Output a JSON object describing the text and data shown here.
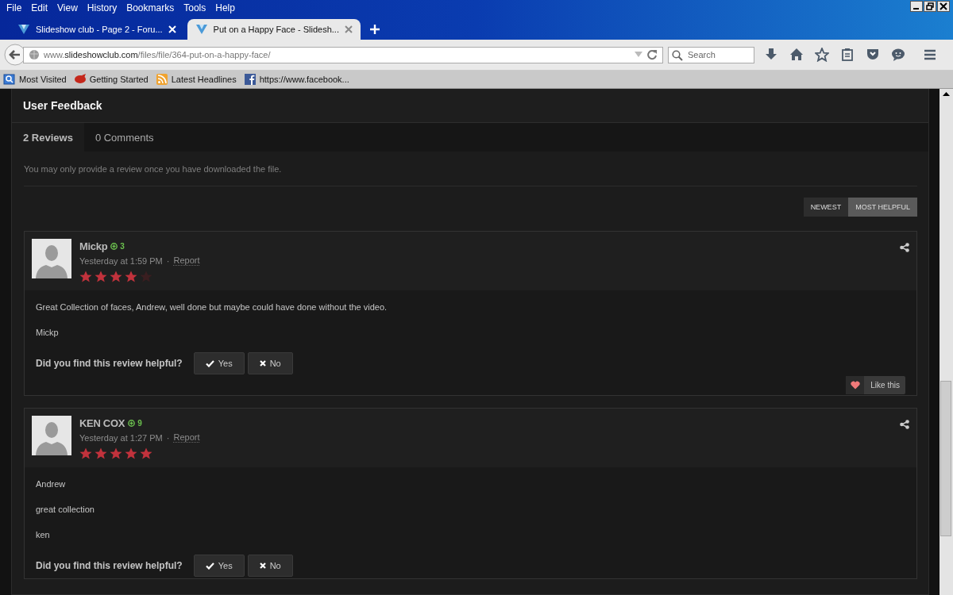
{
  "browser": {
    "menu": [
      "File",
      "Edit",
      "View",
      "History",
      "Bookmarks",
      "Tools",
      "Help"
    ],
    "tabs": [
      {
        "title": "Slideshow club - Page 2 - Foru...",
        "selected": false
      },
      {
        "title": "Put on a Happy Face - Slidesh...",
        "selected": true
      }
    ],
    "address": {
      "prefix": "www.",
      "domain": "slideshowclub.com",
      "path": "/files/file/364-put-on-a-happy-face/"
    },
    "search": {
      "placeholder": "Search"
    },
    "bookmarks": [
      {
        "label": "Most Visited",
        "kind": "folder"
      },
      {
        "label": "Getting Started",
        "kind": "start"
      },
      {
        "label": "Latest Headlines",
        "kind": "feed"
      },
      {
        "label": "https://www.facebook...",
        "kind": "facebook"
      }
    ]
  },
  "feedback": {
    "title": "User Feedback",
    "tabs": [
      {
        "label": "2 Reviews",
        "selected": true
      },
      {
        "label": "0 Comments",
        "selected": false
      }
    ],
    "notice": "You may only provide a review once you have downloaded the file.",
    "sort": [
      {
        "label": "NEWEST",
        "selected": false
      },
      {
        "label": "MOST HELPFUL",
        "selected": true
      }
    ],
    "reviews": [
      {
        "author": "Mickp",
        "reputation": "3",
        "time": "Yesterday at 1:59 PM",
        "separator": "·",
        "report": "Report",
        "stars": 4,
        "paragraphs": [
          "Great Collection of faces, Andrew, well done  but maybe could have done without the video.",
          "Mickp"
        ],
        "question": "Did you find this review helpful?",
        "yes": "Yes",
        "no": "No",
        "like": "Like this"
      },
      {
        "author": "KEN COX",
        "reputation": "9",
        "time": "Yesterday at 1:27 PM",
        "separator": "·",
        "report": "Report",
        "stars": 5,
        "paragraphs": [
          "Andrew",
          "great collection",
          "ken"
        ],
        "question": "Did you find this review helpful?",
        "yes": "Yes",
        "no": "No"
      }
    ]
  }
}
